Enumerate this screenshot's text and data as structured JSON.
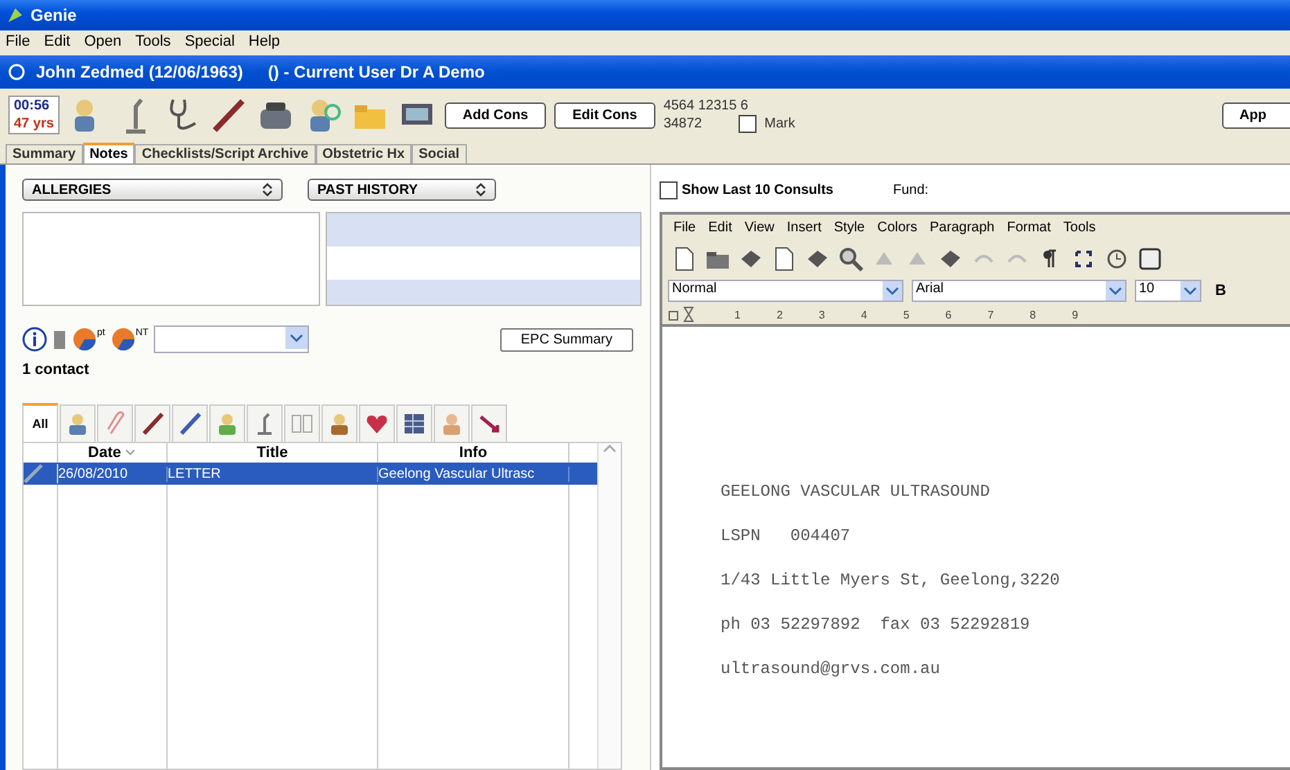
{
  "window": {
    "title": "Genie"
  },
  "menu": [
    "File",
    "Edit",
    "Open",
    "Tools",
    "Special",
    "Help"
  ],
  "patient_bar": {
    "name": "John Zedmed (12/06/1963)",
    "user": "() - Current User Dr A Demo"
  },
  "toolbar": {
    "timer": "00:56",
    "age": "47 yrs",
    "buttons": [
      "Add Cons",
      "Edit Cons"
    ],
    "numbers": [
      "4564 12315 6",
      "34872"
    ],
    "mark": {
      "label": "Mark",
      "checked": false
    },
    "right_button": "App"
  },
  "tabs": [
    {
      "label": "Summary",
      "selected": false
    },
    {
      "label": "Notes",
      "selected": true
    },
    {
      "label": "Checklists/Script Archive",
      "selected": false
    },
    {
      "label": "Obstetric Hx",
      "selected": false
    },
    {
      "label": "Social",
      "selected": false
    }
  ],
  "left_panel": {
    "allergies": "ALLERGIES",
    "past_history": "PAST HISTORY",
    "pt_label": "pt",
    "nt_label": "NT",
    "epc_button": "EPC Summary",
    "contact_count": "1 contact",
    "category_tabs": [
      {
        "kind": "text",
        "label": "All",
        "selected": true
      },
      {
        "kind": "icon",
        "selected": false
      },
      {
        "kind": "icon",
        "selected": false
      },
      {
        "kind": "icon",
        "selected": false
      },
      {
        "kind": "icon",
        "selected": false
      },
      {
        "kind": "icon",
        "selected": false
      },
      {
        "kind": "icon",
        "selected": false
      },
      {
        "kind": "icon",
        "selected": false
      },
      {
        "kind": "icon",
        "selected": false
      },
      {
        "kind": "icon",
        "selected": false
      },
      {
        "kind": "icon",
        "selected": false
      },
      {
        "kind": "icon",
        "selected": false
      },
      {
        "kind": "icon",
        "selected": false
      }
    ],
    "table": {
      "columns": [
        "Date",
        "Title",
        "Info"
      ],
      "rows": [
        {
          "date": "26/08/2010",
          "title": "LETTER",
          "info": "Geelong Vascular Ultrasc",
          "selected": true
        }
      ]
    }
  },
  "right_panel": {
    "show_last": {
      "label": "Show Last 10 Consults",
      "checked": false
    },
    "fund_label": "Fund:",
    "editor": {
      "menu": [
        "File",
        "Edit",
        "View",
        "Insert",
        "Style",
        "Colors",
        "Paragraph",
        "Format",
        "Tools"
      ],
      "style": "Normal",
      "font": "Arial",
      "size": "10",
      "bold_button": "B",
      "ruler": [
        "1",
        "2",
        "3",
        "4",
        "5",
        "6",
        "7",
        "8",
        "9"
      ],
      "document": [
        "GEELONG VASCULAR ULTRASOUND",
        "LSPN   004407",
        "1/43 Little Myers St, Geelong,3220",
        "ph 03 52297892  fax 03 52292819",
        "ultrasound@grvs.com.au"
      ]
    }
  }
}
